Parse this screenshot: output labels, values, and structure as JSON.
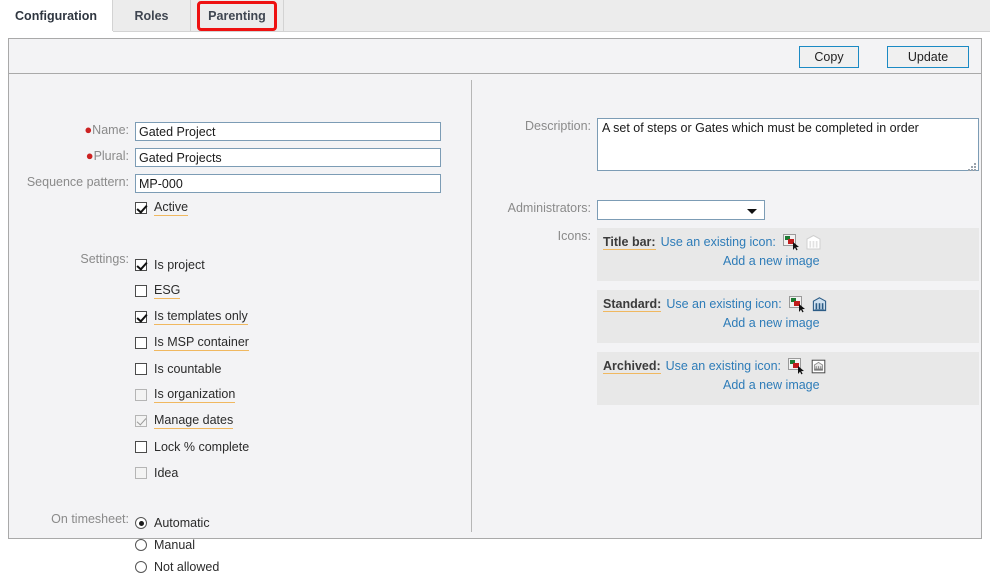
{
  "tabs": [
    {
      "label": "Configuration",
      "active": true
    },
    {
      "label": "Roles",
      "active": false
    },
    {
      "label": "Parenting",
      "active": false,
      "highlighted": true
    }
  ],
  "toolbar": {
    "copy_label": "Copy",
    "update_label": "Update"
  },
  "form": {
    "name": {
      "label": "Name:",
      "value": "Gated Project",
      "required": true
    },
    "plural": {
      "label": "Plural:",
      "value": "Gated Projects",
      "required": true
    },
    "sequence_pattern": {
      "label": "Sequence pattern:",
      "value": "MP-000",
      "required": false
    },
    "active": {
      "label": "Active",
      "checked": true,
      "disabled": false
    },
    "settings_label": "Settings:",
    "settings": [
      {
        "label": "Is project",
        "checked": true,
        "disabled": false,
        "help": false
      },
      {
        "label": "ESG",
        "checked": false,
        "disabled": false,
        "help": true
      },
      {
        "label": "Is templates only",
        "checked": true,
        "disabled": false,
        "help": true
      },
      {
        "label": "Is MSP container",
        "checked": false,
        "disabled": false,
        "help": true
      },
      {
        "label": "Is countable",
        "checked": false,
        "disabled": false,
        "help": false
      },
      {
        "label": "Is organization",
        "checked": false,
        "disabled": true,
        "help": true
      },
      {
        "label": "Manage dates",
        "checked": true,
        "disabled": true,
        "help": true
      },
      {
        "label": "Lock % complete",
        "checked": false,
        "disabled": false,
        "help": false
      },
      {
        "label": "Idea",
        "checked": false,
        "disabled": true,
        "help": false
      }
    ],
    "on_timesheet_label": "On timesheet:",
    "on_timesheet_options": [
      {
        "label": "Automatic",
        "selected": true
      },
      {
        "label": "Manual",
        "selected": false
      },
      {
        "label": "Not allowed",
        "selected": false
      }
    ]
  },
  "right": {
    "description": {
      "label": "Description:",
      "value": "A set of steps or Gates which must be completed in order"
    },
    "administrators": {
      "label": "Administrators:",
      "value": ""
    },
    "icons_label": "Icons:",
    "icon_rows": [
      {
        "key": "Title bar:",
        "link": "Use an existing icon:",
        "add": "Add a new image",
        "icon": "institution-white-icon"
      },
      {
        "key": "Standard:",
        "link": "Use an existing icon:",
        "add": "Add a new image",
        "icon": "institution-blue-icon"
      },
      {
        "key": "Archived:",
        "link": "Use an existing icon:",
        "add": "Add a new image",
        "icon": "institution-gray-icon"
      }
    ],
    "picker_icon": "color-picker-icon"
  },
  "colors": {
    "accent_link": "#2e7cb8",
    "button_border": "#1b8ac4",
    "help_underline": "#f0b860",
    "required_marker": "#cc2222",
    "annotation": "#ee1111",
    "panel_bg": "#f3f3f5",
    "icon_box_bg": "#e8e8e8"
  }
}
